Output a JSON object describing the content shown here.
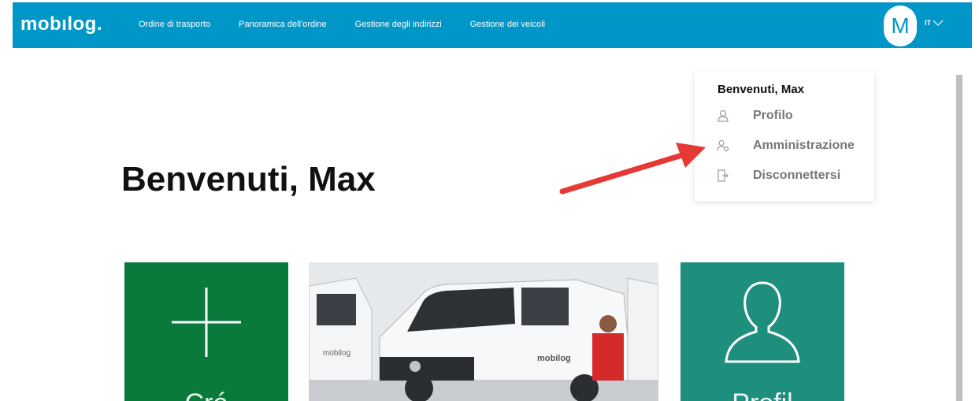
{
  "topbar": {
    "logo": "mobılog.",
    "nav": [
      "Ordine di trasporto",
      "Panoramica dell'ordine",
      "Gestione degli indirizzi",
      "Gestione dei veicoli"
    ],
    "avatar_letter": "M",
    "language": "IT",
    "color": "#0096c8"
  },
  "user_menu": {
    "greeting": "Benvenuti, Max",
    "items": [
      {
        "label": "Profilo",
        "icon": "user-icon"
      },
      {
        "label": "Amministrazione",
        "icon": "admin-user-icon"
      },
      {
        "label": "Disconnettersi",
        "icon": "logout-icon"
      }
    ]
  },
  "main": {
    "heading": "Benvenuti, Max",
    "tiles": [
      {
        "label": "Cré",
        "icon": "plus-icon",
        "color": "#0a7a3c"
      },
      {
        "label": "mobilog",
        "icon": "van-photo"
      },
      {
        "label": "Profil",
        "icon": "user-outline-icon",
        "color": "#1e8f7c"
      }
    ]
  },
  "annotation": {
    "arrow_color": "#e53935"
  }
}
